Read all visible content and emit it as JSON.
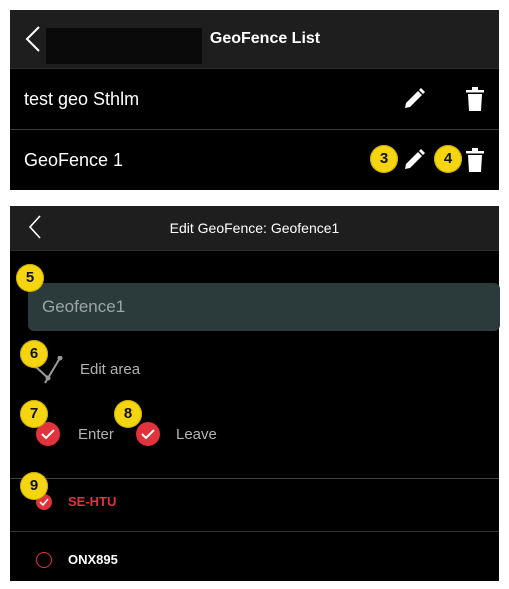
{
  "geofence_list": {
    "title": "GeoFence List",
    "items": [
      {
        "label": "test geo Sthlm"
      },
      {
        "label": "GeoFence 1"
      }
    ]
  },
  "edit_geofence": {
    "title": "Edit GeoFence: Geofence1",
    "name_value": "Geofence1",
    "edit_area_label": "Edit area",
    "enter_label": "Enter",
    "leave_label": "Leave",
    "vehicles": [
      {
        "label": "SE-HTU",
        "checked": true
      },
      {
        "label": "ONX895",
        "checked": false
      }
    ]
  },
  "badges": {
    "b3": "3",
    "b4": "4",
    "b5": "5",
    "b6": "6",
    "b7": "7",
    "b8": "8",
    "b9": "9"
  },
  "colors": {
    "accent_red": "#e0333b",
    "badge_yellow": "#f5d50f",
    "background": "#000000",
    "header": "#1e1e1e"
  },
  "icons": [
    "chevron-left-icon",
    "pencil-icon",
    "trash-icon",
    "polygon-edit-icon",
    "checkmark-icon"
  ]
}
